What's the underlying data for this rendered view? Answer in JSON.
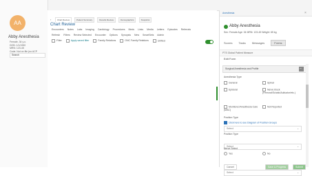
{
  "window": {
    "chrome_label": "Epic",
    "tab_label": "Abb..."
  },
  "patient": {
    "avatar_initials": "AA",
    "name": "Abby Anesthesia",
    "lines": [
      "Female, 34 y.o.",
      "DOB: 1/1/1990",
      "MRN: 123-45",
      "Code: Not on file (no ACP docs)"
    ],
    "search_placeholder": "Search"
  },
  "chart_review": {
    "tabs": [
      "Chart Review",
      "Patient Summary",
      "Results Review",
      "Demographics",
      "Snapshot"
    ],
    "title": "Chart Review",
    "subtabs": [
      "Encounters",
      "Notes",
      "Labs",
      "Imaging",
      "Cardiology",
      "Procedures",
      "Meds",
      "Links",
      "Media",
      "Letters",
      "Episodes",
      "Referrals"
    ],
    "toolbar": [
      "Refresh",
      "Filters",
      "Review Selected",
      "Encounter",
      "Options",
      "Synopsis",
      "New",
      "SmartSets",
      "Admin"
    ],
    "filter_row": [
      "Filter",
      "Apply saved filter",
      "Family Relations",
      "ONC Family Relations",
      "Unfiled"
    ]
  },
  "panel": {
    "app_label": "Anesthesia",
    "patient_name": "Abby Anesthesia",
    "meta": "Sex: Female  Age: 34  MRN: 123-45  Weight: 65 kg",
    "tabs": [
      "Scores",
      "Tasks",
      "Messages",
      "Forms"
    ],
    "breadcrumb": "PTS Global Patient Measure",
    "edit_form": "Edit Form",
    "form_title": "Surgical Anesthesia and Profile",
    "anesthesia_type_label": "Anesthesia Type",
    "anesthesia_types": [
      "General",
      "Spinal",
      "Epidural",
      "Nerve block (Femoral/Sciatic/Adductor/etc.)",
      "Monitored Anesthesia Care (MAC)",
      "Not Reported"
    ],
    "position_label": "Position Type",
    "position_link": "Click here to see Diagram of Position Groups",
    "position_select": "Select",
    "position_type_label": "Position Type",
    "position_type_select": "Select",
    "nerve_label": "Nerve Select",
    "yes": "Yes",
    "no": "No",
    "second_select": "Select",
    "buttons": {
      "cancel": "Cancel",
      "save_progress": "Save & Progress",
      "submit": "Submit"
    }
  },
  "colors": {
    "accent": "#147c8a",
    "brand_green": "#2f8f2e"
  }
}
